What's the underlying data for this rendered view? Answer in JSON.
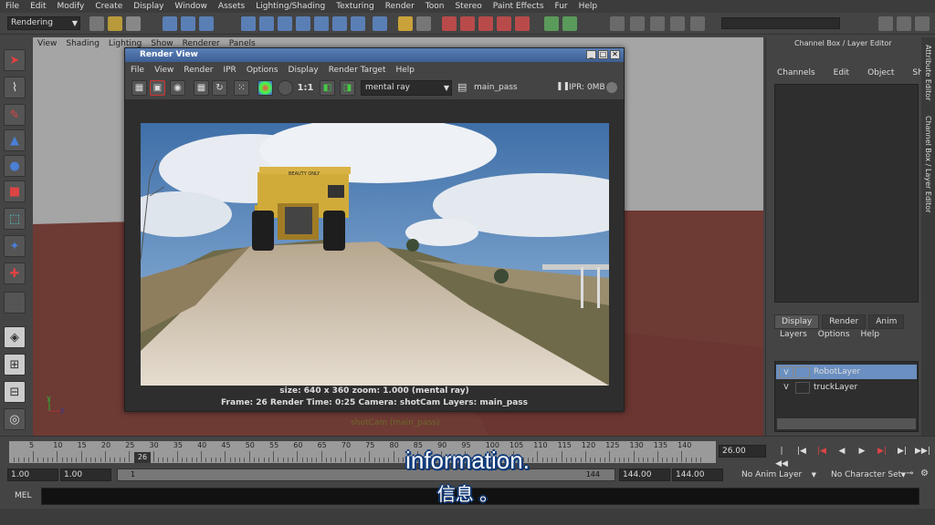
{
  "menubar": [
    "File",
    "Edit",
    "Modify",
    "Create",
    "Display",
    "Window",
    "Assets",
    "Lighting/Shading",
    "Texturing",
    "Render",
    "Toon",
    "Stereo",
    "Paint Effects",
    "Fur",
    "Help"
  ],
  "statusline": {
    "mode": "Rendering"
  },
  "viewport": {
    "menu": [
      "View",
      "Shading",
      "Lighting",
      "Show",
      "Renderer",
      "Panels"
    ],
    "camera_label": "shotCam (main_pass)"
  },
  "channel_box": {
    "title": "Channel Box / Layer Editor",
    "menu": [
      "Channels",
      "Edit",
      "Object",
      "Show"
    ],
    "tabs": [
      "Display",
      "Render",
      "Anim"
    ],
    "layer_menu": [
      "Layers",
      "Options",
      "Help"
    ],
    "layers": [
      {
        "visible": "V",
        "name": "RobotLayer"
      },
      {
        "visible": "V",
        "name": "truckLayer"
      }
    ]
  },
  "side_tabs": [
    "Attribute Editor",
    "Channel Box / Layer Editor"
  ],
  "render_view": {
    "title": "Render View",
    "menu": [
      "File",
      "View",
      "Render",
      "IPR",
      "Options",
      "Display",
      "Render Target",
      "Help"
    ],
    "ratio_label": "1:1",
    "renderer": "mental ray",
    "pass": "main_pass",
    "ipr": "IPR: 0MB",
    "truck_sign": "BEAUTY ONLY",
    "info_line1": "size: 640 x 360  zoom: 1.000        (mental ray)",
    "info_line2": "Frame: 26      Render Time: 0:25      Camera: shotCam      Layers: main_pass"
  },
  "timeline": {
    "ticks": [
      "5",
      "10",
      "15",
      "20",
      "25",
      "30",
      "35",
      "40",
      "45",
      "50",
      "55",
      "60",
      "65",
      "70",
      "75",
      "80",
      "85",
      "90",
      "95",
      "100",
      "105",
      "110",
      "115",
      "120",
      "125",
      "130",
      "135",
      "140"
    ],
    "current_frame": "26",
    "time_field": "26.00"
  },
  "range": {
    "start": "1.00",
    "inner_start": "1.00",
    "bar_start": "1",
    "bar_end": "144",
    "end": "144.00",
    "outer_end": "144.00",
    "anim_layer": "No Anim Layer",
    "char_set": "No Character Set"
  },
  "mel": {
    "label": "MEL"
  },
  "subtitles": {
    "en": "information.",
    "zh": "信息 。"
  },
  "colors": {
    "title_bar": "#3c5f95",
    "layer_selected": "#6a8fc0",
    "ground": "#6e3a34",
    "subtitle_outline": "#0f3a7a"
  }
}
